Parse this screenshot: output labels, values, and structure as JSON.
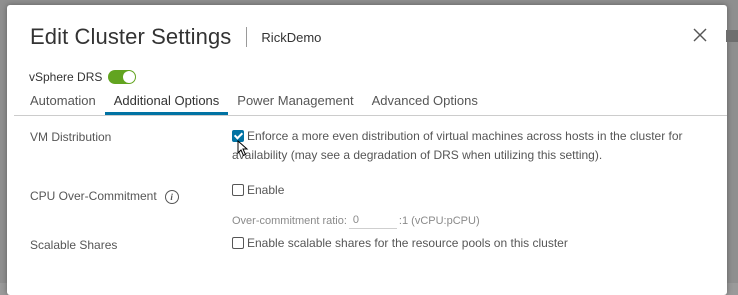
{
  "dialog": {
    "title": "Edit Cluster Settings",
    "subtitle": "RickDemo",
    "close_icon": "close-icon"
  },
  "drs": {
    "label": "vSphere DRS",
    "enabled": true,
    "toggle_color": "#62a420"
  },
  "tabs": [
    {
      "label": "Automation",
      "active": false
    },
    {
      "label": "Additional Options",
      "active": true
    },
    {
      "label": "Power Management",
      "active": false
    },
    {
      "label": "Advanced Options",
      "active": false
    }
  ],
  "options": {
    "vm_distribution": {
      "label": "VM Distribution",
      "checked": true,
      "text_line1": "Enforce a more even distribution of virtual machines across hosts in the cluster for",
      "text_line2": "availability (may see a degradation of DRS when utilizing this setting)."
    },
    "cpu_overcommit": {
      "label": "CPU Over-Commitment",
      "info_icon": "info-icon",
      "checked": false,
      "checkbox_label": "Enable",
      "ratio_label": "Over-commitment ratio:",
      "ratio_value": "0",
      "ratio_suffix": ":1 (vCPU:pCPU)"
    },
    "scalable_shares": {
      "label": "Scalable Shares",
      "checked": false,
      "checkbox_label": "Enable scalable shares for the resource pools on this cluster"
    }
  },
  "colors": {
    "accent": "#0072a3",
    "text": "#565656",
    "toggle_on": "#62a420"
  }
}
